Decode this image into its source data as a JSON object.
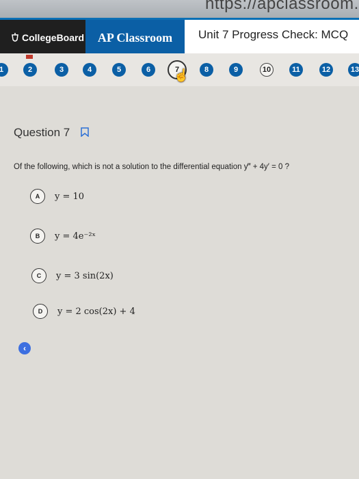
{
  "browser": {
    "url_fragment": "https://apclassroom.c"
  },
  "header": {
    "brand": "CollegeBoard",
    "app_tab": "AP Classroom",
    "unit_title": "Unit 7 Progress Check: MCQ"
  },
  "nav": {
    "questions": [
      "1",
      "2",
      "3",
      "4",
      "5",
      "6",
      "7",
      "8",
      "9",
      "10",
      "11",
      "12",
      "13"
    ],
    "current": "7",
    "unanswered": [
      "10"
    ]
  },
  "question": {
    "title": "Question 7",
    "prompt": "Of the following, which is not a solution to the differential equation y‴ + 4y′ = 0 ?",
    "choices": [
      {
        "letter": "A",
        "text": "y = 10"
      },
      {
        "letter": "B",
        "text": "y = 4e⁻²ˣ"
      },
      {
        "letter": "C",
        "text": "y = 3 sin(2x)"
      },
      {
        "letter": "D",
        "text": "y = 2 cos(2x) + 4"
      }
    ]
  },
  "controls": {
    "back_icon": "chevron-left-icon",
    "bookmark_icon": "bookmark-icon"
  },
  "colors": {
    "accent": "#0b5fa5",
    "back": "#3d6fe0",
    "flag": "#c0392b"
  }
}
